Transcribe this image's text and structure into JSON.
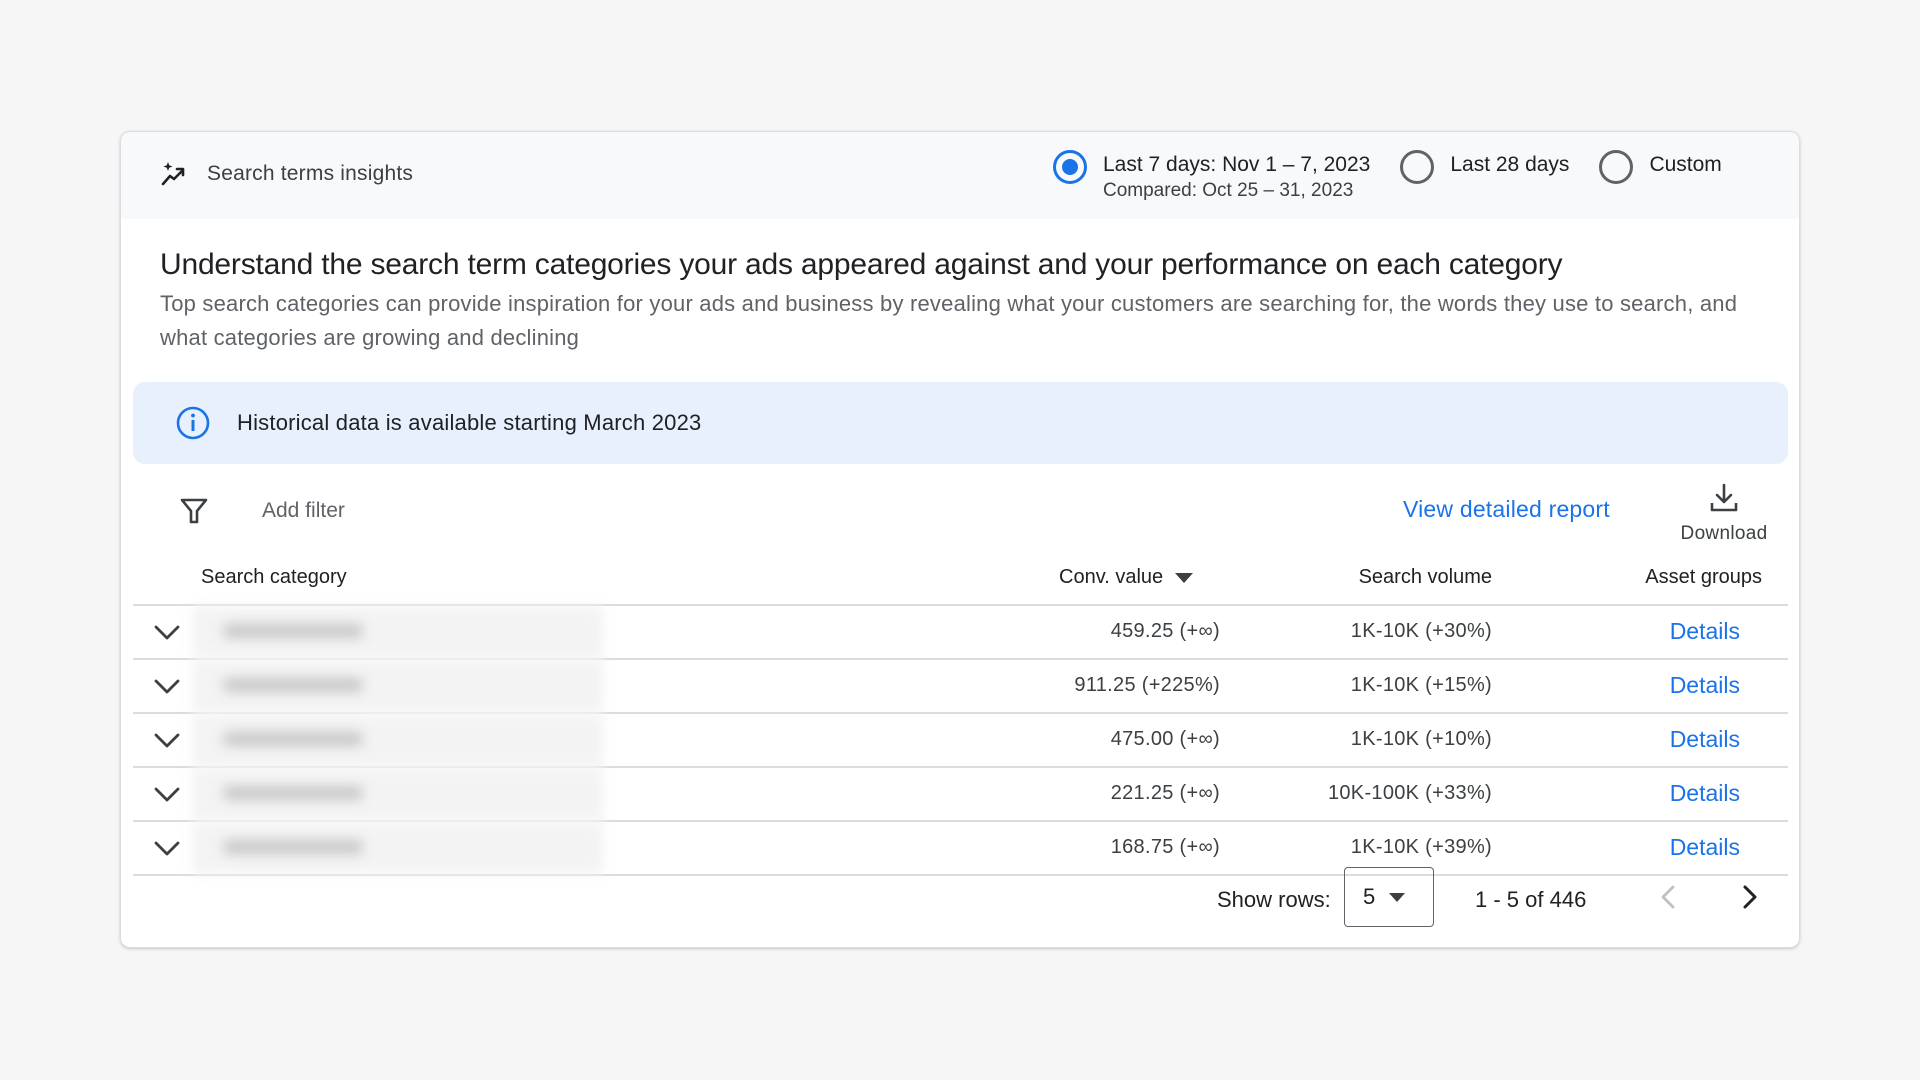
{
  "header": {
    "title": "Search terms insights",
    "icon": "trending-sparkle-icon"
  },
  "date_range": {
    "options": [
      {
        "label": "Last 7 days: Nov 1 – 7, 2023",
        "sub": "Compared: Oct 25 – 31, 2023",
        "selected": true
      },
      {
        "label": "Last 28 days",
        "selected": false
      },
      {
        "label": "Custom",
        "selected": false
      }
    ]
  },
  "intro": {
    "headline": "Understand the search term categories your ads appeared against and your performance on each category",
    "description": "Top search categories can provide inspiration for your ads and business by revealing what your customers are searching for, the words they use to search, and what categories are growing and declining"
  },
  "banner": {
    "icon": "info-icon",
    "text": "Historical data is available starting March 2023"
  },
  "toolbar": {
    "filter_icon": "filter-icon",
    "add_filter": "Add filter",
    "view_report": "View detailed report",
    "download_icon": "download-icon",
    "download_label": "Download"
  },
  "table": {
    "columns": {
      "category": "Search category",
      "conv_value": "Conv. value",
      "search_volume": "Search volume",
      "asset_groups": "Asset groups"
    },
    "sort_column": "conv_value",
    "sort_direction": "descending",
    "rows": [
      {
        "conv_value": "459.25 (+∞)",
        "search_volume": "1K-10K (+30%)",
        "asset_groups": "Details"
      },
      {
        "conv_value": "911.25 (+225%)",
        "search_volume": "1K-10K (+15%)",
        "asset_groups": "Details"
      },
      {
        "conv_value": "475.00 (+∞)",
        "search_volume": "1K-10K (+10%)",
        "asset_groups": "Details"
      },
      {
        "conv_value": "221.25 (+∞)",
        "search_volume": "10K-100K (+33%)",
        "asset_groups": "Details"
      },
      {
        "conv_value": "168.75 (+∞)",
        "search_volume": "1K-10K (+39%)",
        "asset_groups": "Details"
      }
    ]
  },
  "pagination": {
    "show_rows_label": "Show rows:",
    "rows_per_page": "5",
    "range": "1 - 5 of 446",
    "prev_icon": "chevron-left-icon",
    "next_icon": "chevron-right-icon"
  },
  "colors": {
    "accent": "#1a73e8",
    "banner_bg": "#e8f0fe",
    "topbar_bg": "#f8f9fa",
    "page_bg": "#f6f6f6"
  }
}
